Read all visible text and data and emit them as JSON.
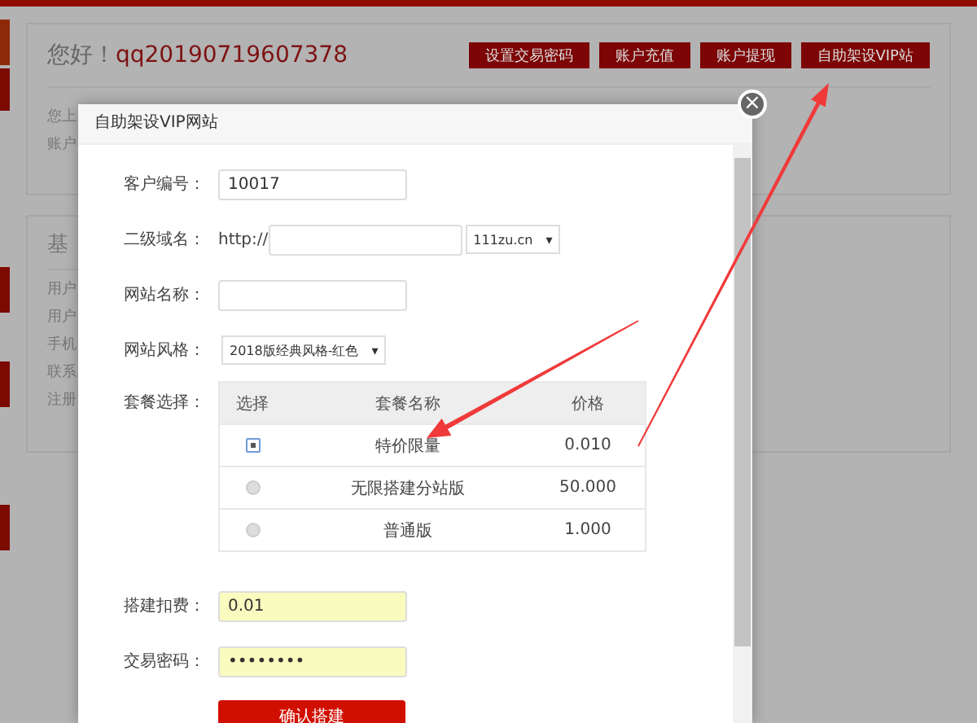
{
  "header": {
    "greeting": "您好！",
    "username": "qq20190719607378",
    "buttons": [
      "设置交易密码",
      "账户充值",
      "账户提现",
      "自助架设VIP站"
    ]
  },
  "side_tabs": [
    {
      "selected": true
    },
    {
      "selected": false
    },
    {
      "selected": false
    },
    {
      "selected": false
    },
    {
      "selected": false
    }
  ],
  "account_card": {
    "lines": [
      "您上",
      "账户"
    ]
  },
  "basic_card": {
    "title": "基",
    "lines": [
      "用户",
      "用户",
      "手机",
      "联系",
      "注册"
    ]
  },
  "modal": {
    "title": "自助架设VIP网站",
    "close": "×",
    "customer_id": {
      "label": "客户编号：",
      "value": "10017"
    },
    "subdomain": {
      "label": "二级域名：",
      "prefix": "http://",
      "domain": "111zu.cn",
      "caret": "▾"
    },
    "site_name": {
      "label": "网站名称："
    },
    "style": {
      "label": "网站风格：",
      "value": "2018版经典风格-红色",
      "caret": "▾"
    },
    "packages": {
      "label": "套餐选择：",
      "columns": [
        "选择",
        "套餐名称",
        "价格"
      ],
      "rows": [
        {
          "name": "特价限量",
          "price": "0.010",
          "selected": true
        },
        {
          "name": "无限搭建分站版",
          "price": "50.000",
          "selected": false
        },
        {
          "name": "普通版",
          "price": "1.000",
          "selected": false
        }
      ]
    },
    "fee": {
      "label": "搭建扣费：",
      "value": "0.01"
    },
    "password": {
      "label": "交易密码：",
      "value": "••••••••"
    },
    "submit": "确认搭建"
  }
}
